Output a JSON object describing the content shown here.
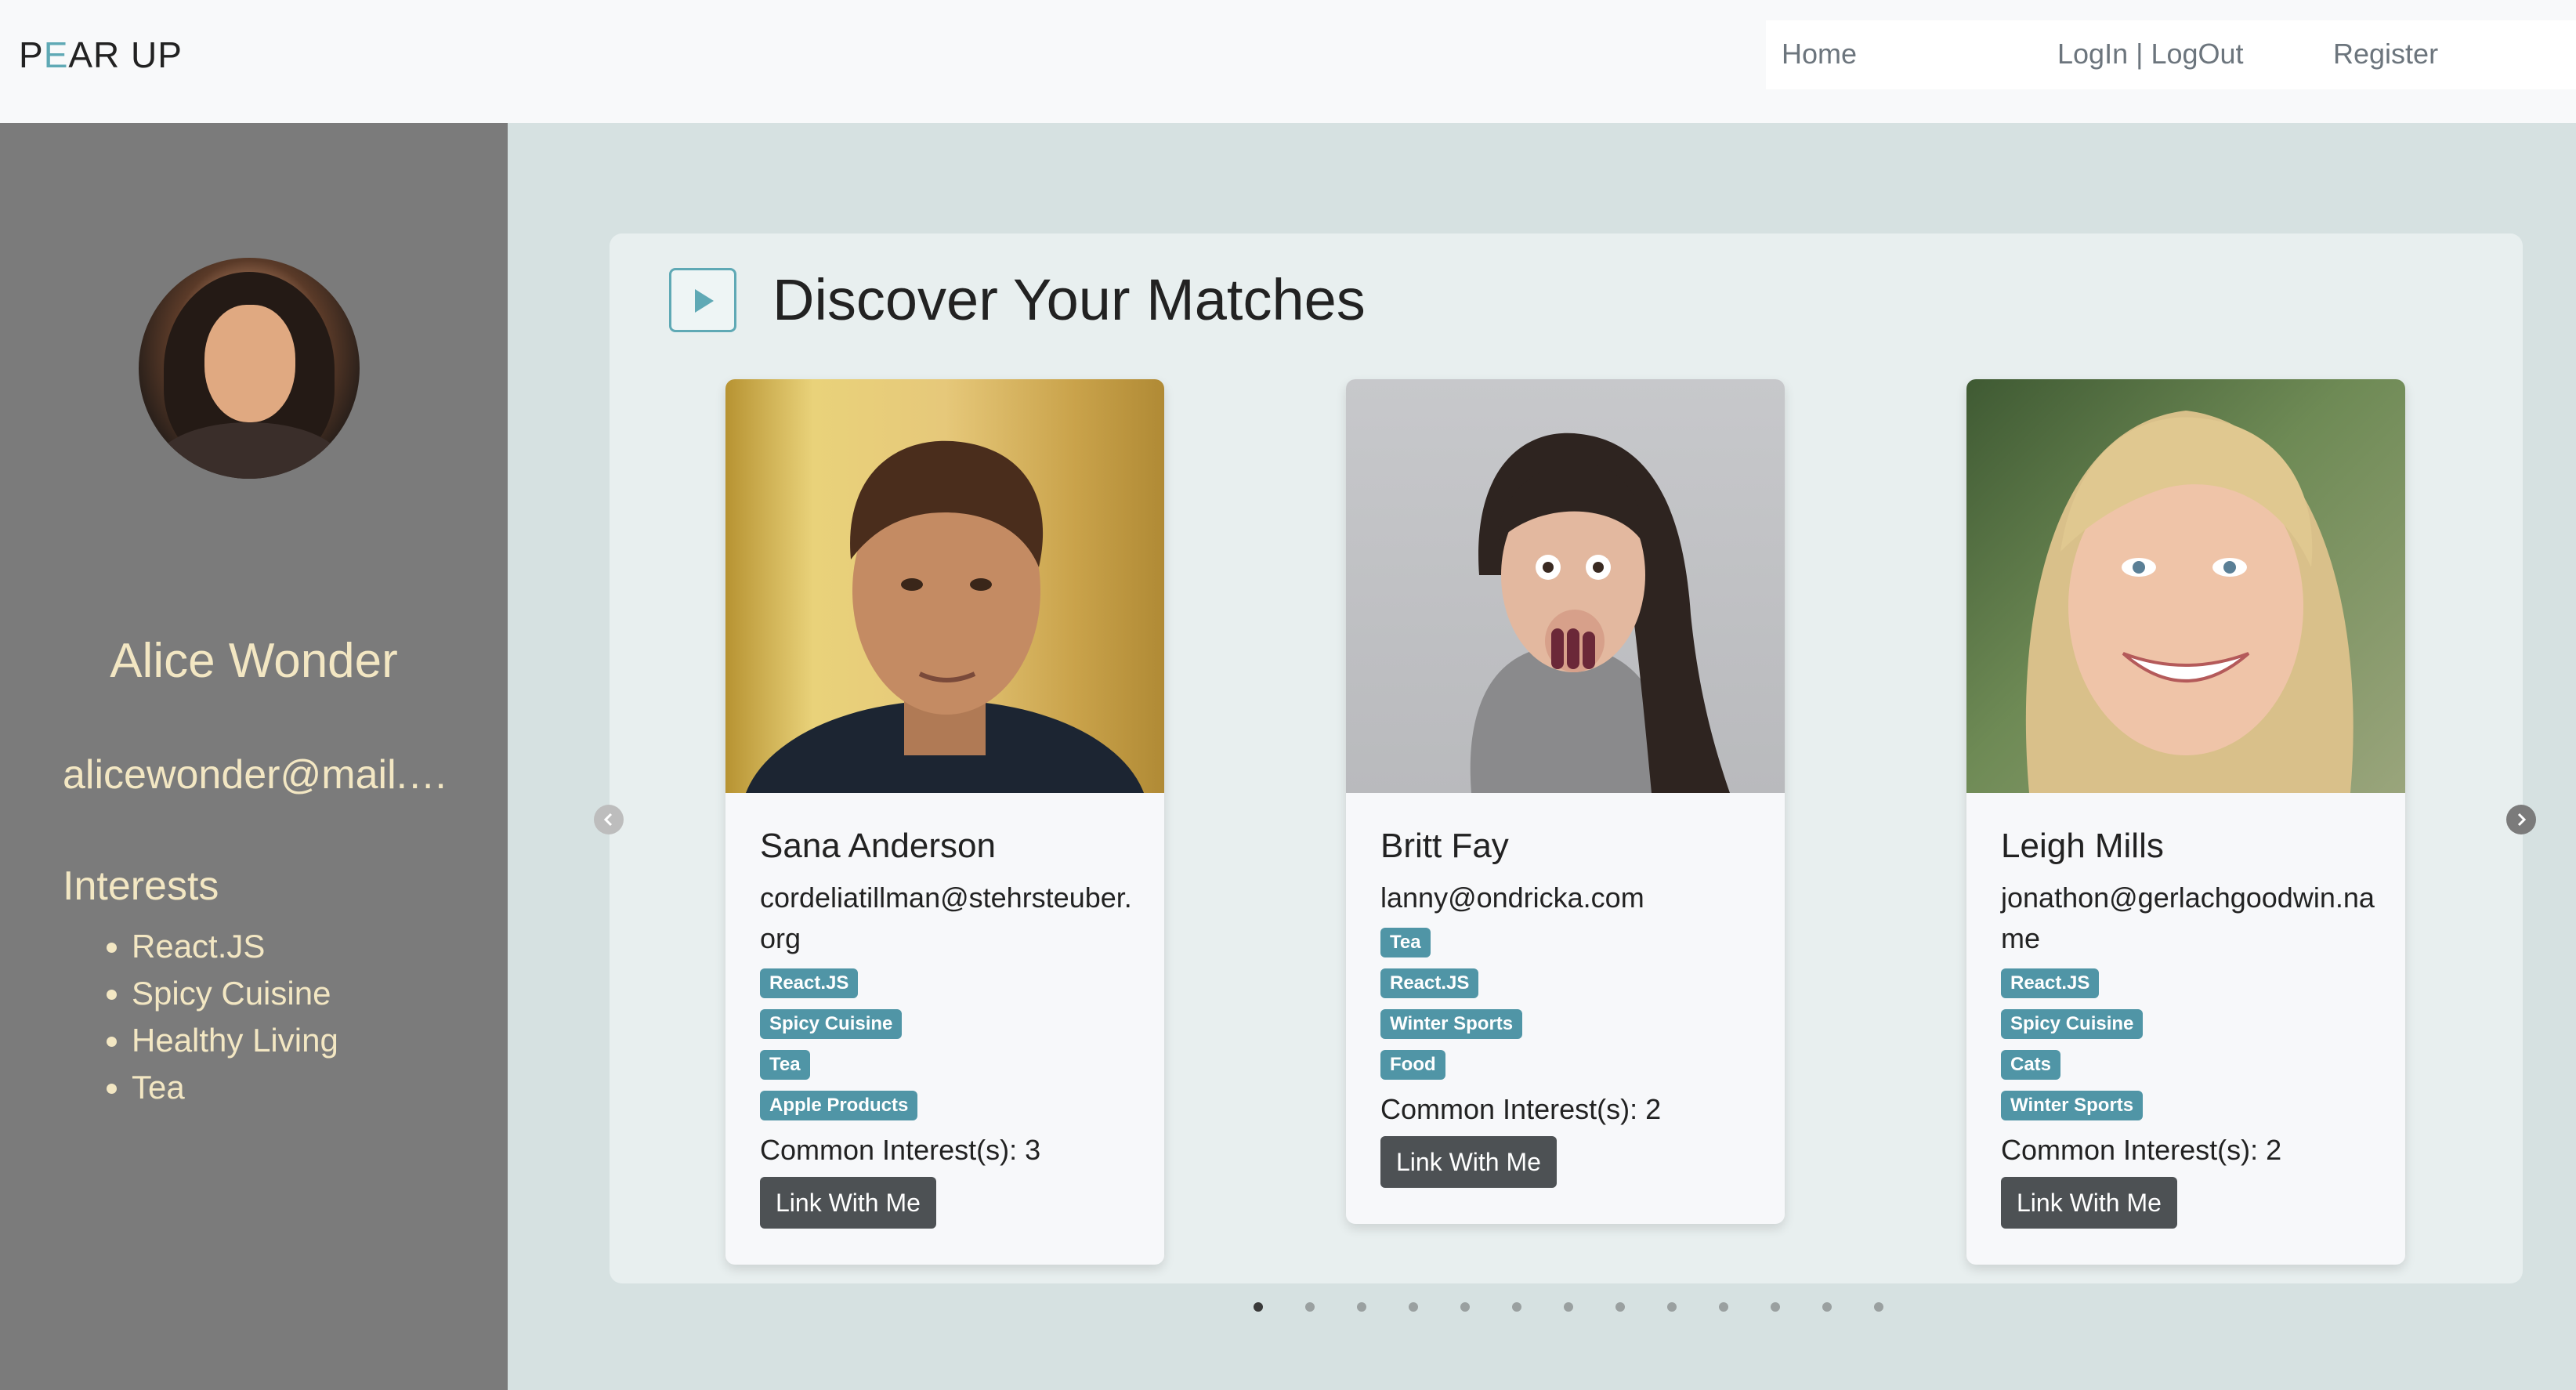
{
  "navbar": {
    "brand_prefix": "P",
    "brand_accent": "E",
    "brand_suffix": "AR UP",
    "links": [
      "Home",
      "LogIn | LogOut",
      "Register"
    ]
  },
  "sidebar": {
    "name": "Alice Wonder",
    "email": "alicewonder@mail.com",
    "interests_title": "Interests",
    "interests": [
      "React.JS",
      "Spicy Cuisine",
      "Healthy Living",
      "Tea"
    ]
  },
  "main": {
    "title": "Discover Your Matches",
    "cards": [
      {
        "name": "Sana Anderson",
        "email": "cordeliatillman@stehrsteuber.org",
        "tags": [
          "React.JS",
          "Spicy Cuisine",
          "Tea",
          "Apple Products"
        ],
        "common": "Common Interest(s): 3",
        "button": "Link With Me"
      },
      {
        "name": "Britt Fay",
        "email": "lanny@ondricka.com",
        "tags": [
          "Tea",
          "React.JS",
          "Winter Sports",
          "Food"
        ],
        "common": "Common Interest(s): 2",
        "button": "Link With Me"
      },
      {
        "name": "Leigh Mills",
        "email": "jonathon@gerlachgoodwin.name",
        "tags": [
          "React.JS",
          "Spicy Cuisine",
          "Cats",
          "Winter Sports"
        ],
        "common": "Common Interest(s): 2",
        "button": "Link With Me"
      }
    ],
    "pagination": {
      "total": 13,
      "active": 1
    }
  },
  "colors": {
    "accent": "#5fa9b5",
    "tag": "#5095a6",
    "sidebar_bg": "#7b7b7b",
    "sidebar_text": "#f3e7c3",
    "button_bg": "#4d5154"
  }
}
